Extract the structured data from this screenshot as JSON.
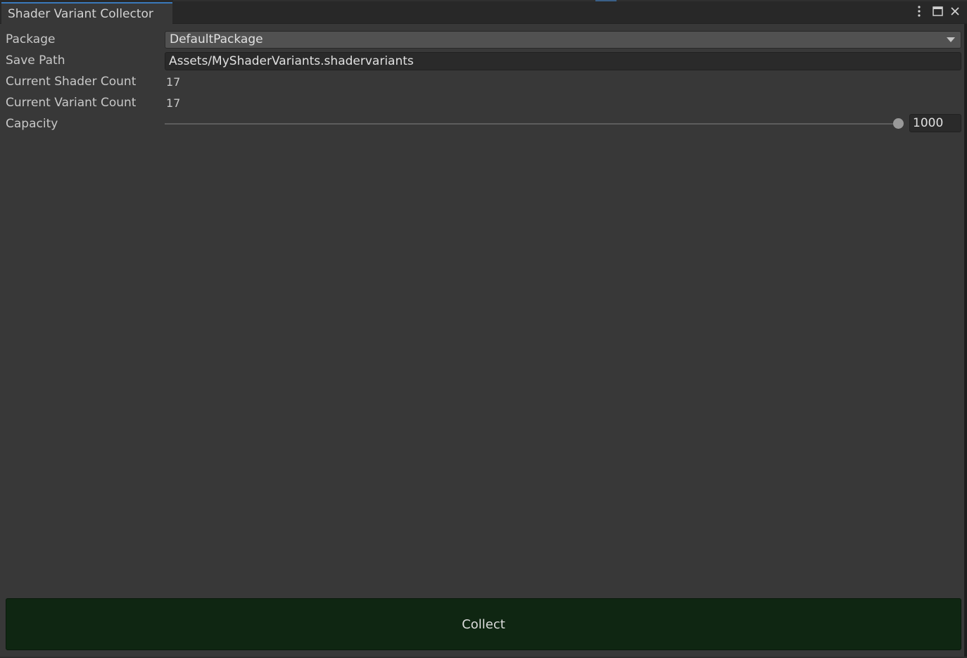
{
  "window": {
    "title": "Shader Variant Collector",
    "controls": {
      "menu_icon": "kebab-menu-icon",
      "maximize_icon": "maximize-icon",
      "close_icon": "close-icon"
    }
  },
  "form": {
    "package": {
      "label": "Package",
      "value": "DefaultPackage"
    },
    "save_path": {
      "label": "Save Path",
      "value": "Assets/MyShaderVariants.shadervariants"
    },
    "shader_count": {
      "label": "Current Shader Count",
      "value": "17"
    },
    "variant_count": {
      "label": "Current Variant Count",
      "value": "17"
    },
    "capacity": {
      "label": "Capacity",
      "value": "1000",
      "slider_fraction": 1.0
    }
  },
  "actions": {
    "collect_label": "Collect"
  },
  "colors": {
    "background": "#383838",
    "tab_accent": "#3a79bb",
    "collect_button": "#0f2612"
  }
}
